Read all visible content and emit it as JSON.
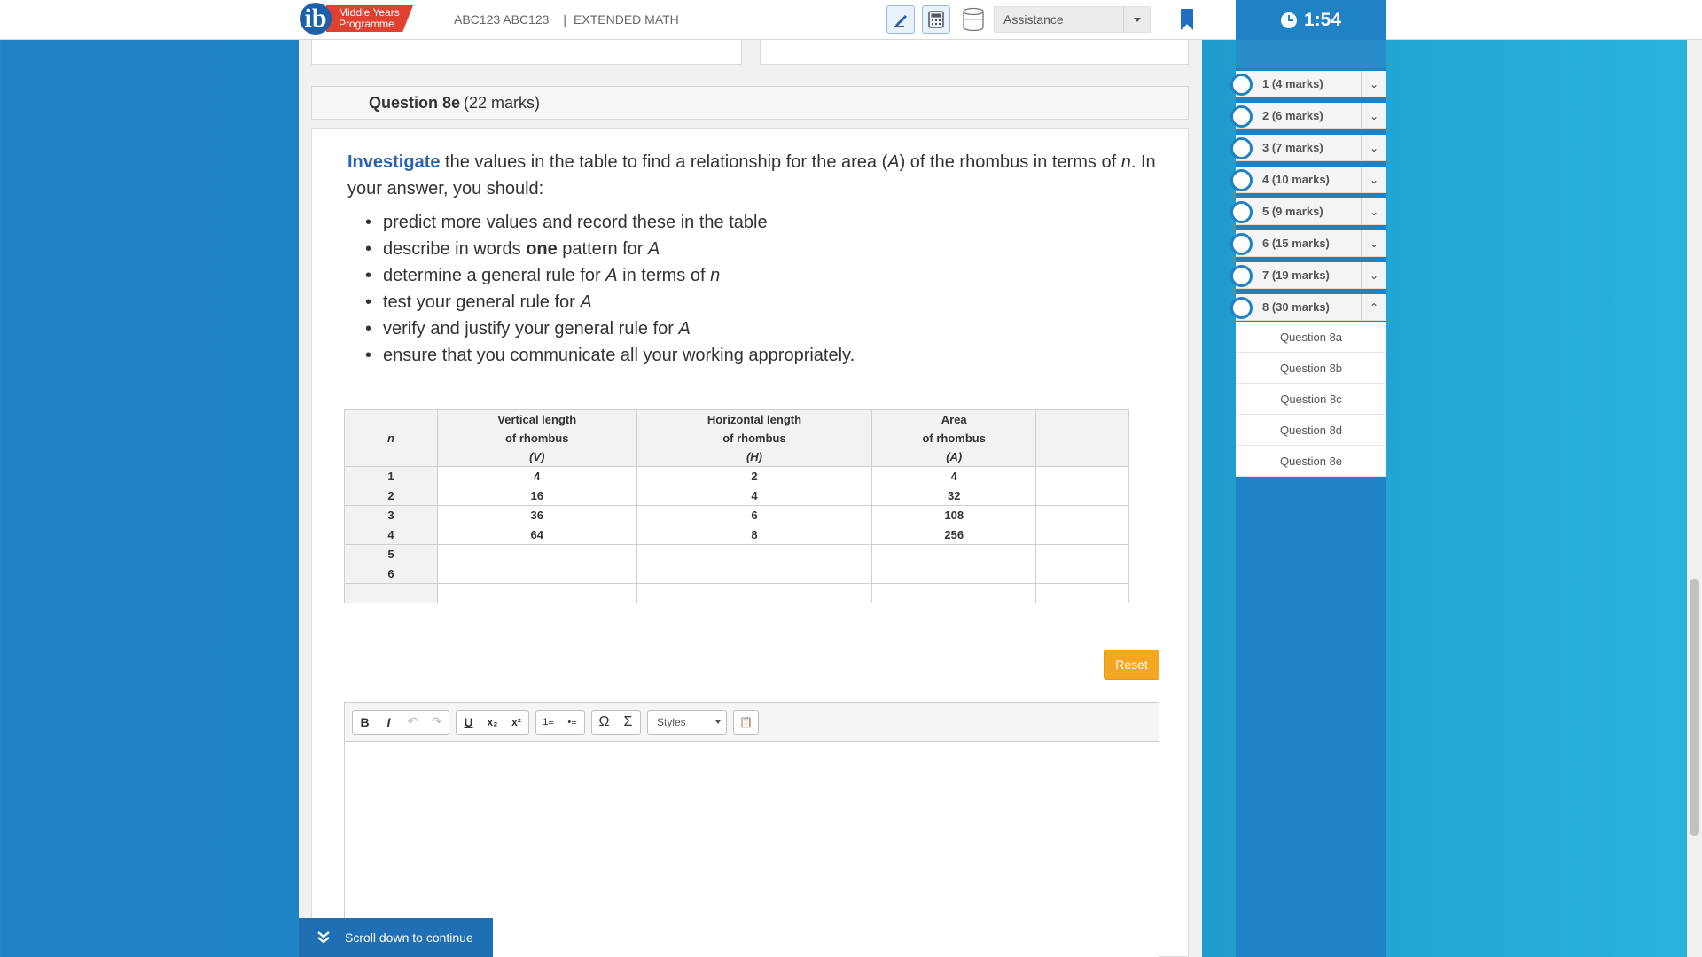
{
  "header": {
    "logo_line1": "Middle Years",
    "logo_line2": "Programme",
    "logo_letter": "ib",
    "candidate": "ABC123 ABC123",
    "separator": "|",
    "subject": "EXTENDED MATH",
    "tools": [
      "pen-icon",
      "calculator-icon",
      "cylinder-icon"
    ],
    "assistance_label": "Assistance",
    "bookmark_icon": "bookmark-icon"
  },
  "timer": {
    "value": "1:54"
  },
  "question": {
    "title": "Question 8e",
    "marks": "(22 marks)",
    "prompt_keyword": "Investigate",
    "prompt_part1": " the values in the table to find a relationship for the area (",
    "prompt_var_A": "A",
    "prompt_part2": ") of the rhombus in terms of ",
    "prompt_var_n": "n",
    "prompt_part3": ". In your answer, you should:",
    "bullets": [
      {
        "pre": "predict more values and record these in the table",
        "bold": "",
        "post": "",
        "var": "",
        "post2": "",
        "var2": ""
      },
      {
        "pre": "describe in words ",
        "bold": "one",
        "post": " pattern for ",
        "var": "A",
        "post2": "",
        "var2": ""
      },
      {
        "pre": "determine a general rule for ",
        "bold": "",
        "post": "",
        "var": "A",
        "post2": " in terms of ",
        "var2": "n"
      },
      {
        "pre": "test your general rule for ",
        "bold": "",
        "post": "",
        "var": "A",
        "post2": "",
        "var2": ""
      },
      {
        "pre": "verify and justify your general rule for ",
        "bold": "",
        "post": "",
        "var": "A",
        "post2": "",
        "var2": ""
      },
      {
        "pre": "ensure that you communicate all your working appropriately.",
        "bold": "",
        "post": "",
        "var": "",
        "post2": "",
        "var2": ""
      }
    ]
  },
  "table": {
    "headers": [
      {
        "lines": [
          "n"
        ]
      },
      {
        "lines": [
          "Vertical length",
          "of rhombus",
          "(V)"
        ]
      },
      {
        "lines": [
          "Horizontal length",
          "of rhombus",
          "(H)"
        ]
      },
      {
        "lines": [
          "Area",
          "of rhombus",
          "(A)"
        ]
      },
      {
        "lines": [
          ""
        ]
      }
    ],
    "rows": [
      [
        "1",
        "4",
        "2",
        "4",
        ""
      ],
      [
        "2",
        "16",
        "4",
        "32",
        ""
      ],
      [
        "3",
        "36",
        "6",
        "108",
        ""
      ],
      [
        "4",
        "64",
        "8",
        "256",
        ""
      ],
      [
        "5",
        "",
        "",
        "",
        ""
      ],
      [
        "6",
        "",
        "",
        "",
        ""
      ],
      [
        "",
        "",
        "",
        "",
        ""
      ]
    ]
  },
  "reset_label": "Reset",
  "editor": {
    "toolbar": {
      "bold": "B",
      "italic": "I",
      "undo": "↶",
      "redo": "↷",
      "underline": "U",
      "subscript": "x₂",
      "superscript": "x²",
      "ordered_list": "1≡",
      "bullet_list": "•≡",
      "omega": "Ω",
      "sigma": "Σ",
      "styles": "Styles",
      "paste": "📋"
    }
  },
  "scroll_banner": {
    "label": "Scroll down to continue"
  },
  "sidebar": {
    "sections": [
      {
        "label": "1 (4 marks)",
        "toggle": "⌄"
      },
      {
        "label": "2 (6 marks)",
        "toggle": "⌄"
      },
      {
        "label": "3 (7 marks)",
        "toggle": "⌄"
      },
      {
        "label": "4 (10 marks)",
        "toggle": "⌄"
      },
      {
        "label": "5 (9 marks)",
        "toggle": "⌄"
      },
      {
        "label": "6 (15 marks)",
        "toggle": "⌄"
      },
      {
        "label": "7 (19 marks)",
        "toggle": "⌄"
      },
      {
        "label": "8 (30 marks)",
        "toggle": "⌃"
      }
    ],
    "subitems": [
      "Question 8a",
      "Question 8b",
      "Question 8c",
      "Question 8d",
      "Question 8e"
    ]
  }
}
